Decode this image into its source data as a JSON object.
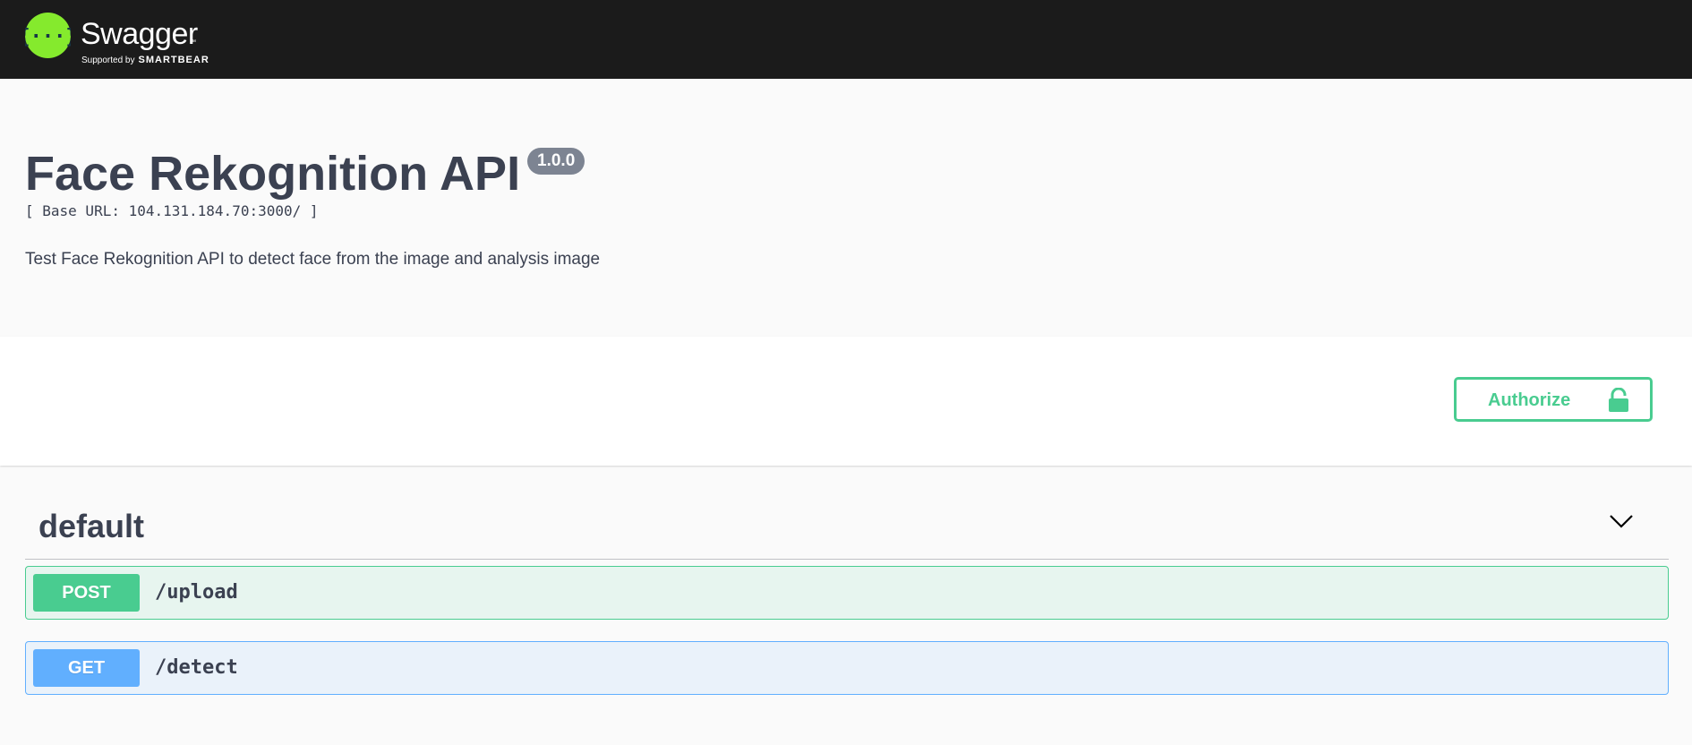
{
  "topbar": {
    "logo_word": "Swagger",
    "logo_tm": "™",
    "supported_by": "Supported by",
    "brand": "SMARTBEAR"
  },
  "info": {
    "title": "Face Rekognition API",
    "version": "1.0.0",
    "base_url": "[ Base URL: 104.131.184.70:3000/ ]",
    "description": "Test Face Rekognition API to detect face from the image and analysis image"
  },
  "scheme": {
    "authorize_label": "Authorize"
  },
  "operations": {
    "tag": "default",
    "items": [
      {
        "method": "POST",
        "path": "/upload"
      },
      {
        "method": "GET",
        "path": "/detect"
      }
    ]
  },
  "colors": {
    "topbar_bg": "#1b1b1b",
    "logo_green": "#85ea2d",
    "post_green": "#49cc90",
    "get_blue": "#61affe",
    "text": "#3b4151",
    "version_badge": "#7d8492"
  },
  "icons": {
    "logo": "swagger-logo-icon",
    "authorize": "lock-icon",
    "tag_toggle": "chevron-down-icon"
  }
}
